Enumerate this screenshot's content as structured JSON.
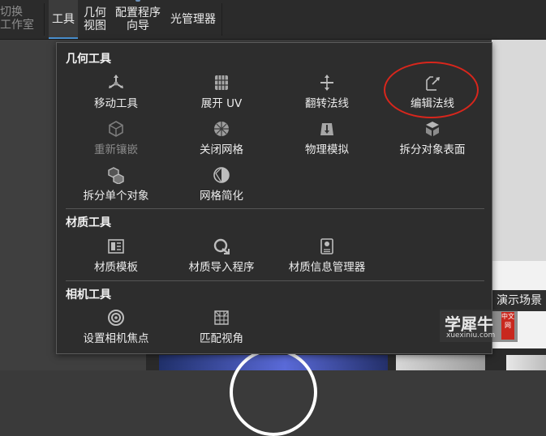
{
  "toolbar": {
    "switch_workspace": {
      "line1": "切换",
      "line2": "工作室"
    },
    "tools": "工具",
    "geometry": {
      "line1": "几何",
      "line2": "视图"
    },
    "config_wizard": {
      "line1": "配置程序",
      "line2": "向导"
    },
    "light_manager": "光管理器"
  },
  "menu": {
    "sections": [
      {
        "title": "几何工具",
        "items": [
          {
            "label": "移动工具",
            "icon": "move-tool-icon",
            "enabled": true
          },
          {
            "label": "展开 UV",
            "icon": "unwrap-uv-icon",
            "enabled": true
          },
          {
            "label": "翻转法线",
            "icon": "flip-normals-icon",
            "enabled": true
          },
          {
            "label": "编辑法线",
            "icon": "edit-normals-icon",
            "enabled": true
          },
          {
            "label": "重新镶嵌",
            "icon": "retessellate-icon",
            "enabled": false
          },
          {
            "label": "关闭网格",
            "icon": "close-mesh-icon",
            "enabled": true
          },
          {
            "label": "物理模拟",
            "icon": "physics-simulation-icon",
            "enabled": true
          },
          {
            "label": "拆分对象表面",
            "icon": "split-object-surfaces-icon",
            "enabled": true
          },
          {
            "label": "拆分单个对象",
            "icon": "split-single-object-icon",
            "enabled": true
          },
          {
            "label": "网格简化",
            "icon": "mesh-simplify-icon",
            "enabled": true
          }
        ]
      },
      {
        "title": "材质工具",
        "items": [
          {
            "label": "材质模板",
            "icon": "material-template-icon",
            "enabled": true
          },
          {
            "label": "材质导入程序",
            "icon": "material-importer-icon",
            "enabled": true
          },
          {
            "label": "材质信息管理器",
            "icon": "material-info-manager-icon",
            "enabled": true
          }
        ]
      },
      {
        "title": "相机工具",
        "items": [
          {
            "label": "设置相机焦点",
            "icon": "set-camera-focus-icon",
            "enabled": true
          },
          {
            "label": "匹配视角",
            "icon": "match-perspective-icon",
            "enabled": true
          }
        ]
      }
    ]
  },
  "background": {
    "demo_scene": "演示场景"
  },
  "watermark": {
    "brand": "学犀牛",
    "url": "xuexiniu.com",
    "seal": "中文网"
  },
  "colors": {
    "menu_bg": "#2d2d2d",
    "toolbar_bg": "#2b2b2b",
    "annotation_red": "#d8261c",
    "active_tab_underline": "#4a90d0"
  }
}
